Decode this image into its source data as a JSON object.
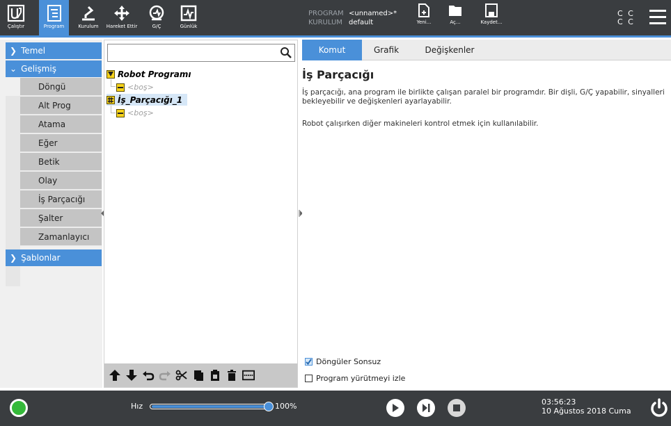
{
  "topbar": {
    "nav": [
      {
        "label": "Çalıştır",
        "icon": "ur-logo-icon"
      },
      {
        "label": "Program",
        "icon": "program-icon",
        "active": true
      },
      {
        "label": "Kurulum",
        "icon": "robot-arm-icon"
      },
      {
        "label": "Hareket Ettir",
        "icon": "move-arrows-icon"
      },
      {
        "label": "G/Ç",
        "icon": "io-icon"
      },
      {
        "label": "Günlük",
        "icon": "log-icon"
      }
    ],
    "program_key": "PROGRAM",
    "program_value": "<unnamed>*",
    "installation_key": "KURULUM",
    "installation_value": "default",
    "file_buttons": [
      {
        "label": "Yeni...",
        "icon": "new-file-icon"
      },
      {
        "label": "Aç...",
        "icon": "open-folder-icon"
      },
      {
        "label": "Kaydet...",
        "icon": "save-icon"
      }
    ],
    "cc_line1": "C C",
    "cc_line2": "C C"
  },
  "leftnav": {
    "basic_label": "Temel",
    "advanced_label": "Gelişmiş",
    "items": [
      "Döngü",
      "Alt Prog",
      "Atama",
      "Eğer",
      "Betik",
      "Olay",
      "İş Parçacığı",
      "Şalter",
      "Zamanlayıcı"
    ],
    "templates_label": "Şablonlar"
  },
  "tree": {
    "search_placeholder": "",
    "robot_program": "Robot Programı",
    "empty1": "<boş>",
    "thread": "İş_Parçacığı_1",
    "empty2": "<boş>"
  },
  "right": {
    "tabs": [
      "Komut",
      "Grafik",
      "Değişkenler"
    ],
    "heading": "İş Parçacığı",
    "para1": "İş parçacığı, ana program ile birlikte çalışan paralel bir programdır. Bir dişli, G/Ç yapabilir, sinyalleri bekleyebilir ve değişkenleri ayarlayabilir.",
    "para2": "Robot çalışırken diğer makineleri kontrol etmek için kullanılabilir.",
    "loop_forever": "Döngüler Sonsuz",
    "loop_forever_checked": true,
    "track_execution": "Program yürütmeyi izle",
    "track_execution_checked": false
  },
  "bottombar": {
    "speed_label": "Hız",
    "speed_value": "100%",
    "speed_fraction": 1.0,
    "time": "03:56:23",
    "date": "10 Ağustos 2018 Cuma"
  },
  "colors": {
    "accent": "#4a90d9",
    "bar": "#3a3d40",
    "status_ok": "#35b93a"
  }
}
